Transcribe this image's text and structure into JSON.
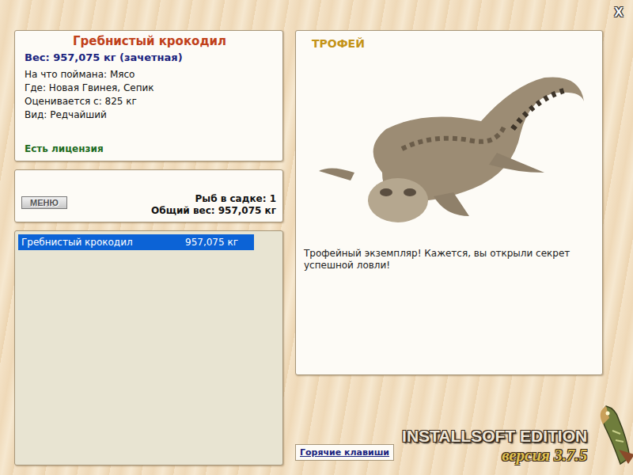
{
  "window": {
    "close": "X"
  },
  "catch": {
    "title": "Гребнистый крокодил",
    "weight": "Вес: 957,075 кг (зачетная)",
    "details": [
      "На что поймана: Мясо",
      "Где: Новая Гвинея, Сепик",
      "Оценивается с: 825 кг",
      "Вид: Редчайший"
    ],
    "license": "Есть лицензия"
  },
  "keepnet": {
    "menu_button": "МЕНЮ",
    "count": "Рыб в садке: 1",
    "total": "Общий вес: 957,075 кг"
  },
  "fish_list": [
    {
      "name": "Гребнистый крокодил",
      "weight": "957,075 кг",
      "selected": true
    }
  ],
  "trophy": {
    "badge": "ТРОФЕЙ",
    "message": "Трофейный экземпляр! Кажется, вы открыли секрет успешной ловли!"
  },
  "hotkeys_button": "Горячие клавиши",
  "logo": {
    "edition": "INSTALLSOFT EDITION",
    "version": "версия 3.7.5"
  }
}
